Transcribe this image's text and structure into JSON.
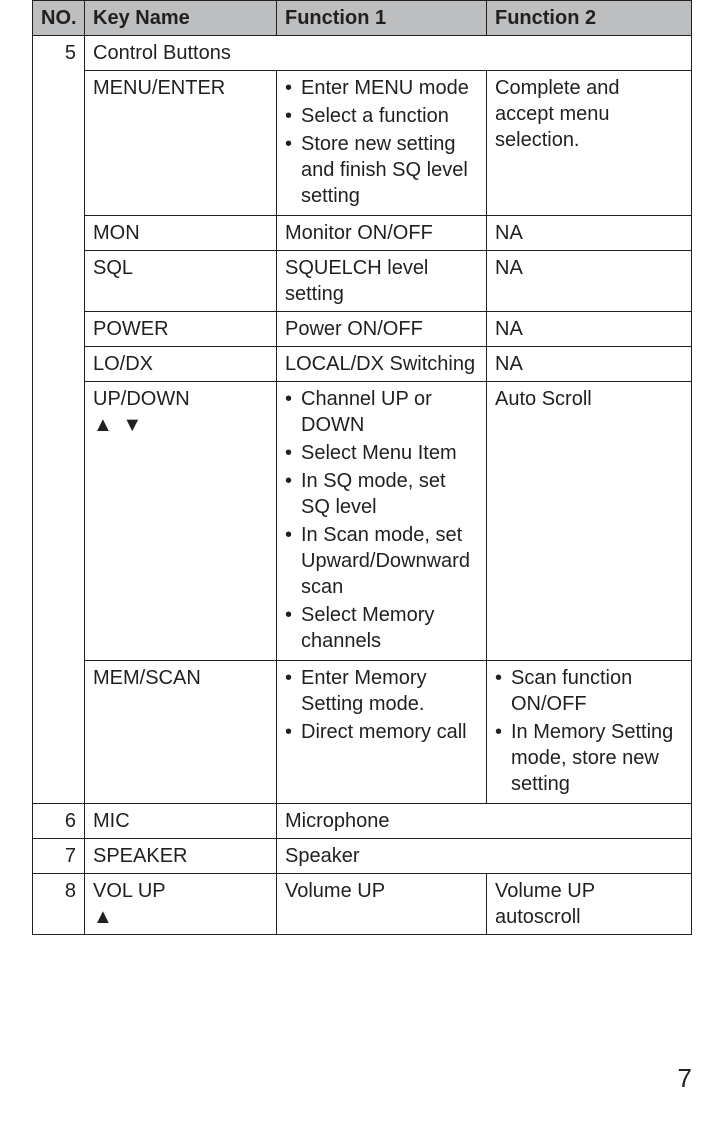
{
  "headers": {
    "no": "NO.",
    "key": "Key Name",
    "f1": "Function 1",
    "f2": "Function 2"
  },
  "row5": {
    "no": "5",
    "title": "Control Buttons",
    "items": {
      "menu_enter": {
        "key": "MENU/ENTER",
        "f1": [
          "Enter MENU mode",
          "Select a function",
          "Store new setting and finish SQ level setting"
        ],
        "f2": "Complete and accept menu selection."
      },
      "mon": {
        "key": "MON",
        "f1": "Monitor ON/OFF",
        "f2": "NA"
      },
      "sql": {
        "key": "SQL",
        "f1": "SQUELCH level setting",
        "f2": "NA"
      },
      "power": {
        "key": "POWER",
        "f1": "Power ON/OFF",
        "f2": "NA"
      },
      "lodx": {
        "key": "LO/DX",
        "f1": "LOCAL/DX Switching",
        "f2": "NA"
      },
      "updown": {
        "key_line1": "UP/DOWN",
        "key_line2": "▲ ▼",
        "f1": [
          "Channel UP or DOWN",
          "Select Menu Item",
          "In SQ mode, set SQ level",
          "In Scan mode, set Upward/Downward scan",
          "Select Memory channels"
        ],
        "f2": "Auto Scroll"
      },
      "memscan": {
        "key": "MEM/SCAN",
        "f1": [
          "Enter Memory Setting mode.",
          "Direct memory call"
        ],
        "f2": [
          "Scan function ON/OFF",
          "In Memory Setting mode, store new setting"
        ]
      }
    }
  },
  "row6": {
    "no": "6",
    "key": "MIC",
    "desc": "Microphone"
  },
  "row7": {
    "no": "7",
    "key": "SPEAKER",
    "desc": "Speaker"
  },
  "row8": {
    "no": "8",
    "key_line1": "VOL UP",
    "key_line2": "▲",
    "f1": "Volume UP",
    "f2": "Volume UP autoscroll"
  },
  "page_number": "7"
}
